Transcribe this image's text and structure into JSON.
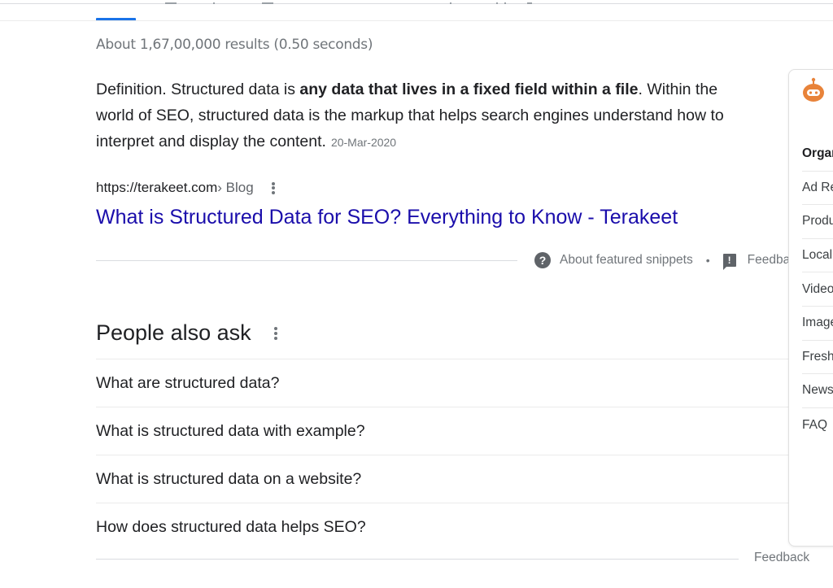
{
  "search": {
    "result_stats": "About 1,67,00,000 results (0.50 seconds)",
    "accent_color": "#1a73e8"
  },
  "featured_snippet": {
    "text_before_bold": "Definition. Structured data is ",
    "bold_text": "any data that lives in a fixed field within a file",
    "text_after_bold": ". Within the world of SEO, structured data is the markup that helps search engines understand how to interpret and display the content.",
    "line1_suffix": ". Within the",
    "line2": "world of SEO, structured data is the markup that helps search engines understand how to",
    "line3": "interpret and display the content.",
    "date": "20-Mar-2020",
    "cite_domain": "https://terakeet.com",
    "cite_path": " › Blog",
    "title": "What is Structured Data for SEO? Everything to Know - Terakeet",
    "title_color": "#1a0dab",
    "footer": {
      "about_label": "About featured snippets",
      "separator": "•",
      "feedback_label": "Feedback",
      "about_icon": "help-circle-icon",
      "feedback_icon": "feedback-icon"
    }
  },
  "people_also_ask": {
    "title": "People also ask",
    "questions": [
      "What are structured data?",
      "What is structured data with example?",
      "What is structured data on a website?",
      "How does structured data helps SEO?"
    ],
    "feedback_label": "Feedback"
  },
  "extension_panel": {
    "icon": "robot-icon",
    "icon_color": "#e8833a",
    "items": [
      "Organic",
      "Ad Results",
      "Products",
      "Local",
      "Videos",
      "Images",
      "Fresh",
      "News",
      "FAQ"
    ]
  }
}
